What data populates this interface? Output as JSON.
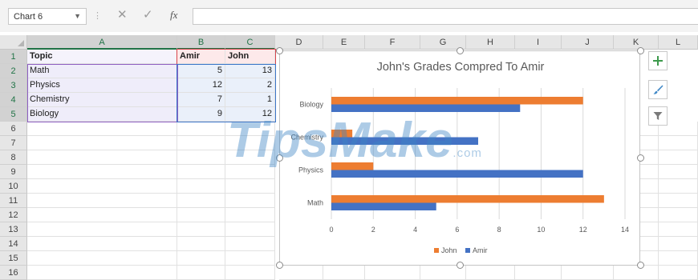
{
  "formula_bar": {
    "name_box": "Chart 6",
    "fx_label": "fx",
    "formula": ""
  },
  "columns": [
    "A",
    "B",
    "C",
    "D",
    "E",
    "F",
    "G",
    "H",
    "I",
    "J",
    "K",
    "L"
  ],
  "rows": [
    "1",
    "2",
    "3",
    "4",
    "5",
    "6",
    "7",
    "8",
    "9",
    "10",
    "11",
    "12",
    "13",
    "14",
    "15",
    "16"
  ],
  "table": {
    "headers": [
      "Topic",
      "Amir",
      "John"
    ],
    "rows": [
      [
        "Math",
        "5",
        "13"
      ],
      [
        "Physics",
        "12",
        "2"
      ],
      [
        "Chemistry",
        "7",
        "1"
      ],
      [
        "Biology",
        "9",
        "12"
      ]
    ]
  },
  "chart_data": {
    "type": "bar",
    "orientation": "horizontal",
    "title": "John's Grades Compred To Amir",
    "categories": [
      "Math",
      "Physics",
      "Chemistry",
      "Biology"
    ],
    "series": [
      {
        "name": "John",
        "values": [
          13,
          2,
          1,
          12
        ],
        "color": "#ed7d31"
      },
      {
        "name": "Amir",
        "values": [
          5,
          12,
          7,
          9
        ],
        "color": "#4472c4"
      }
    ],
    "xlim": [
      0,
      14
    ],
    "xticks": [
      "0",
      "2",
      "4",
      "6",
      "8",
      "10",
      "12",
      "14"
    ],
    "grid": "vertical",
    "legend_position": "bottom"
  },
  "chart_tools": {
    "add_icon": "plus-icon",
    "style_icon": "brush-icon",
    "filter_icon": "filter-icon"
  },
  "watermark": {
    "brand": "TipsMake",
    "suffix": ".com"
  },
  "colors": {
    "excel_green": "#217346",
    "john": "#ed7d31",
    "amir": "#4472c4"
  }
}
